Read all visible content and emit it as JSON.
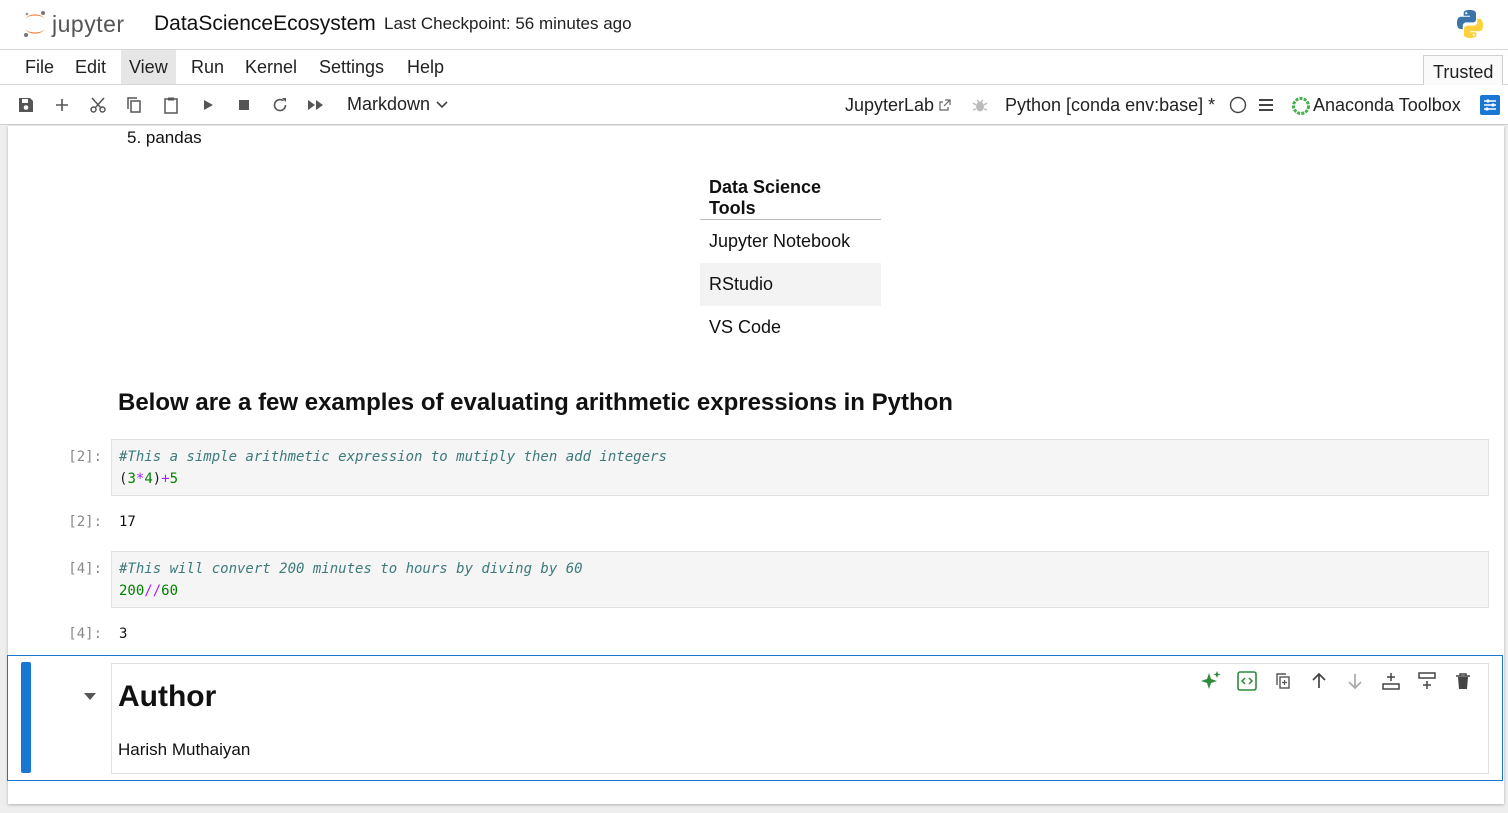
{
  "header": {
    "logo_text": "jupyter",
    "notebook_title": "DataScienceEcosystem",
    "checkpoint": "Last Checkpoint: 56 minutes ago"
  },
  "menubar": {
    "items": [
      "File",
      "Edit",
      "View",
      "Run",
      "Kernel",
      "Settings",
      "Help"
    ],
    "active": "View",
    "trusted_label": "Trusted"
  },
  "toolbar": {
    "cell_type": "Markdown",
    "jupyterlab_link": "JupyterLab",
    "kernel_name": "Python [conda env:base] *",
    "anaconda_label": "Anaconda Toolbox"
  },
  "notebook": {
    "list_item": "5. pandas",
    "table": {
      "header": "Data Science Tools",
      "rows": [
        "Jupyter Notebook",
        "RStudio",
        "VS Code"
      ]
    },
    "section_heading": "Below are a few examples of evaluating arithmetic expressions in Python",
    "cells": [
      {
        "in_prompt": "[2]:",
        "comment": "#This a simple arithmetic expression to mutiply then add integers",
        "code_tokens": [
          "(",
          "3",
          "*",
          "4",
          ")",
          "+",
          "5"
        ],
        "out_prompt": "[2]:",
        "output": "17"
      },
      {
        "in_prompt": "[4]:",
        "comment": "#This will convert 200 minutes to hours by diving by 60",
        "code_tokens": [
          "200",
          "//",
          "60"
        ],
        "out_prompt": "[4]:",
        "output": "3"
      }
    ],
    "author_heading": "Author",
    "author_name": "Harish Muthaiyan"
  },
  "colors": {
    "accent": "#1976d2",
    "anaconda_green": "#43b049",
    "jupyter_orange": "#f37726",
    "comment": "#3d7a7a",
    "number": "#008000",
    "operator": "#aa22ff"
  }
}
